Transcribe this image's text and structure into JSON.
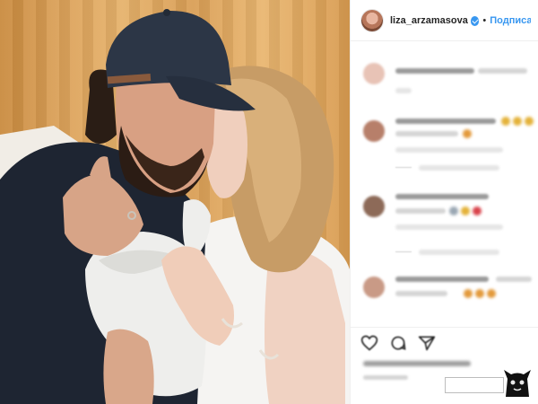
{
  "post": {
    "username": "liza_arzamasova",
    "separator": "•",
    "follow_label": "Подписат"
  },
  "icons": {
    "verified": "verified-badge-icon",
    "like": "heart-icon",
    "comment": "comment-icon",
    "share": "share-icon"
  },
  "colors": {
    "accent": "#3897f0",
    "text": "#262626",
    "border": "#efefef"
  }
}
